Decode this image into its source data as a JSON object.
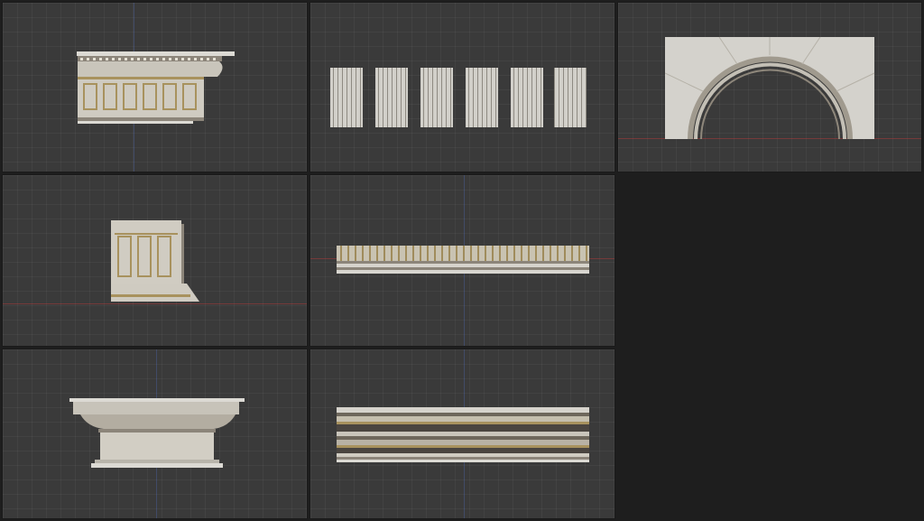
{
  "viewports": [
    {
      "id": "cornice-entablature",
      "content": "cornice-entablature-model",
      "active": false
    },
    {
      "id": "flute-panels",
      "content": "fluted-pilaster-panels-model",
      "active": false
    },
    {
      "id": "arch",
      "content": "stone-arch-model",
      "active": false
    },
    {
      "id": "pedestal-block",
      "content": "pedestal-block-model",
      "active": false
    },
    {
      "id": "frieze-strip",
      "content": "dentil-frieze-strip-model",
      "active": false
    },
    {
      "id": "capital-cap",
      "content": "capital-cornice-cap-model",
      "active": false
    },
    {
      "id": "molding-stack",
      "content": "molding-stack-model",
      "active": false
    }
  ],
  "colors": {
    "viewport_bg": "#3a3a3a",
    "app_bg": "#1e1e1e",
    "stone_light": "#d8d6d0",
    "stone_mid": "#b7b3aa",
    "stone_dark": "#7f7a70",
    "gold_trim": "#a8925e",
    "axis_x": "#be3c3c",
    "axis_y": "#506ebe"
  }
}
